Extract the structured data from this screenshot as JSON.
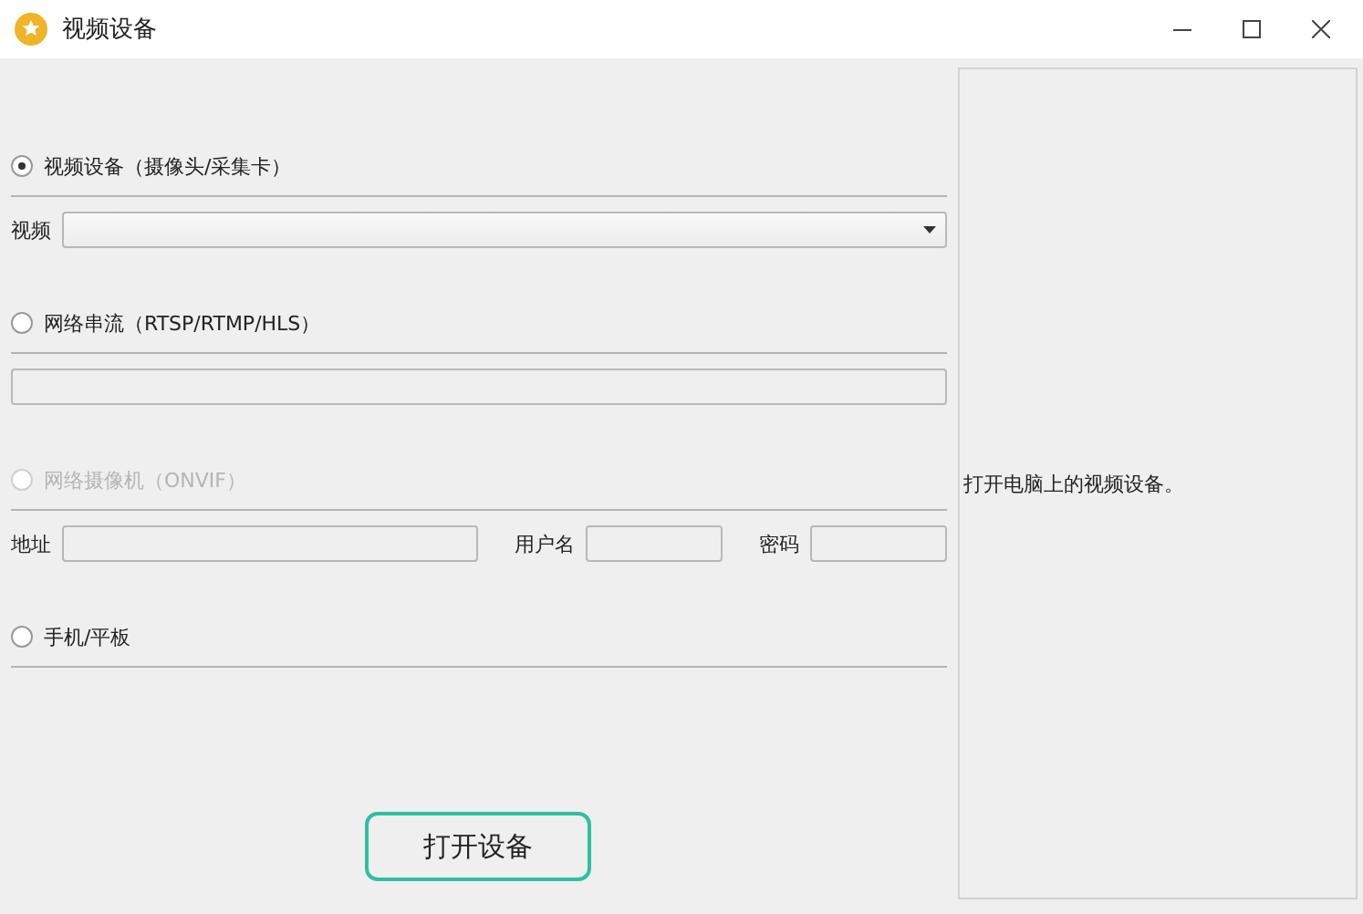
{
  "window": {
    "title": "视频设备"
  },
  "sources": [
    {
      "kind": "select",
      "label": "视频设备（摄像头/采集卡）",
      "selected": true,
      "disabled": false,
      "fields": [
        {
          "label": "视频"
        }
      ]
    },
    {
      "kind": "text",
      "label": "网络串流（RTSP/RTMP/HLS）",
      "selected": false,
      "disabled": false
    },
    {
      "kind": "credentials",
      "label": "网络摄像机（ONVIF）",
      "selected": false,
      "disabled": true,
      "fields": [
        {
          "label": "地址"
        },
        {
          "label": "用户名"
        },
        {
          "label": "密码"
        }
      ]
    },
    {
      "kind": "none",
      "label": "手机/平板",
      "selected": false,
      "disabled": false
    }
  ],
  "open_button": "打开设备",
  "hint": "打开电脑上的视频设备。"
}
